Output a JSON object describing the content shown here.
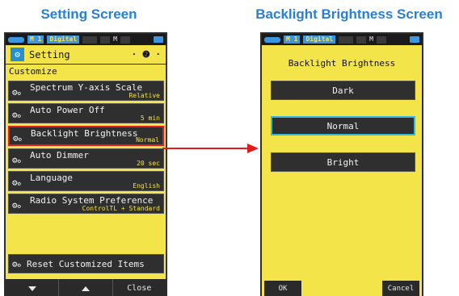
{
  "headings": {
    "left": "Setting Screen",
    "right": "Backlight Brightness Screen"
  },
  "statusbar": {
    "mode_tag": "M 1",
    "mode_label": "Digital",
    "marker": "M"
  },
  "setting_screen": {
    "title": "Setting",
    "page_indicator": "· ❷ ·",
    "section_label": "Customize",
    "items": [
      {
        "label": "Spectrum Y-axis Scale",
        "value": "Relative"
      },
      {
        "label": "Auto Power Off",
        "value": "5 min"
      },
      {
        "label": "Backlight Brightness",
        "value": "Normal"
      },
      {
        "label": "Auto Dimmer",
        "value": "20 sec"
      },
      {
        "label": "Language",
        "value": "English"
      },
      {
        "label": "Radio System Preference",
        "value": "ControlTL + Standard"
      }
    ],
    "reset_label": "Reset Customized Items",
    "close_label": "Close"
  },
  "backlight_screen": {
    "title": "Backlight Brightness",
    "options": [
      "Dark",
      "Normal",
      "Bright"
    ],
    "ok_label": "OK",
    "cancel_label": "Cancel"
  },
  "colors": {
    "device_yellow": "#f3e44a",
    "heading_blue": "#2a7fd2",
    "highlight_red": "#e21c1c",
    "selection_cyan": "#36b8e0"
  }
}
